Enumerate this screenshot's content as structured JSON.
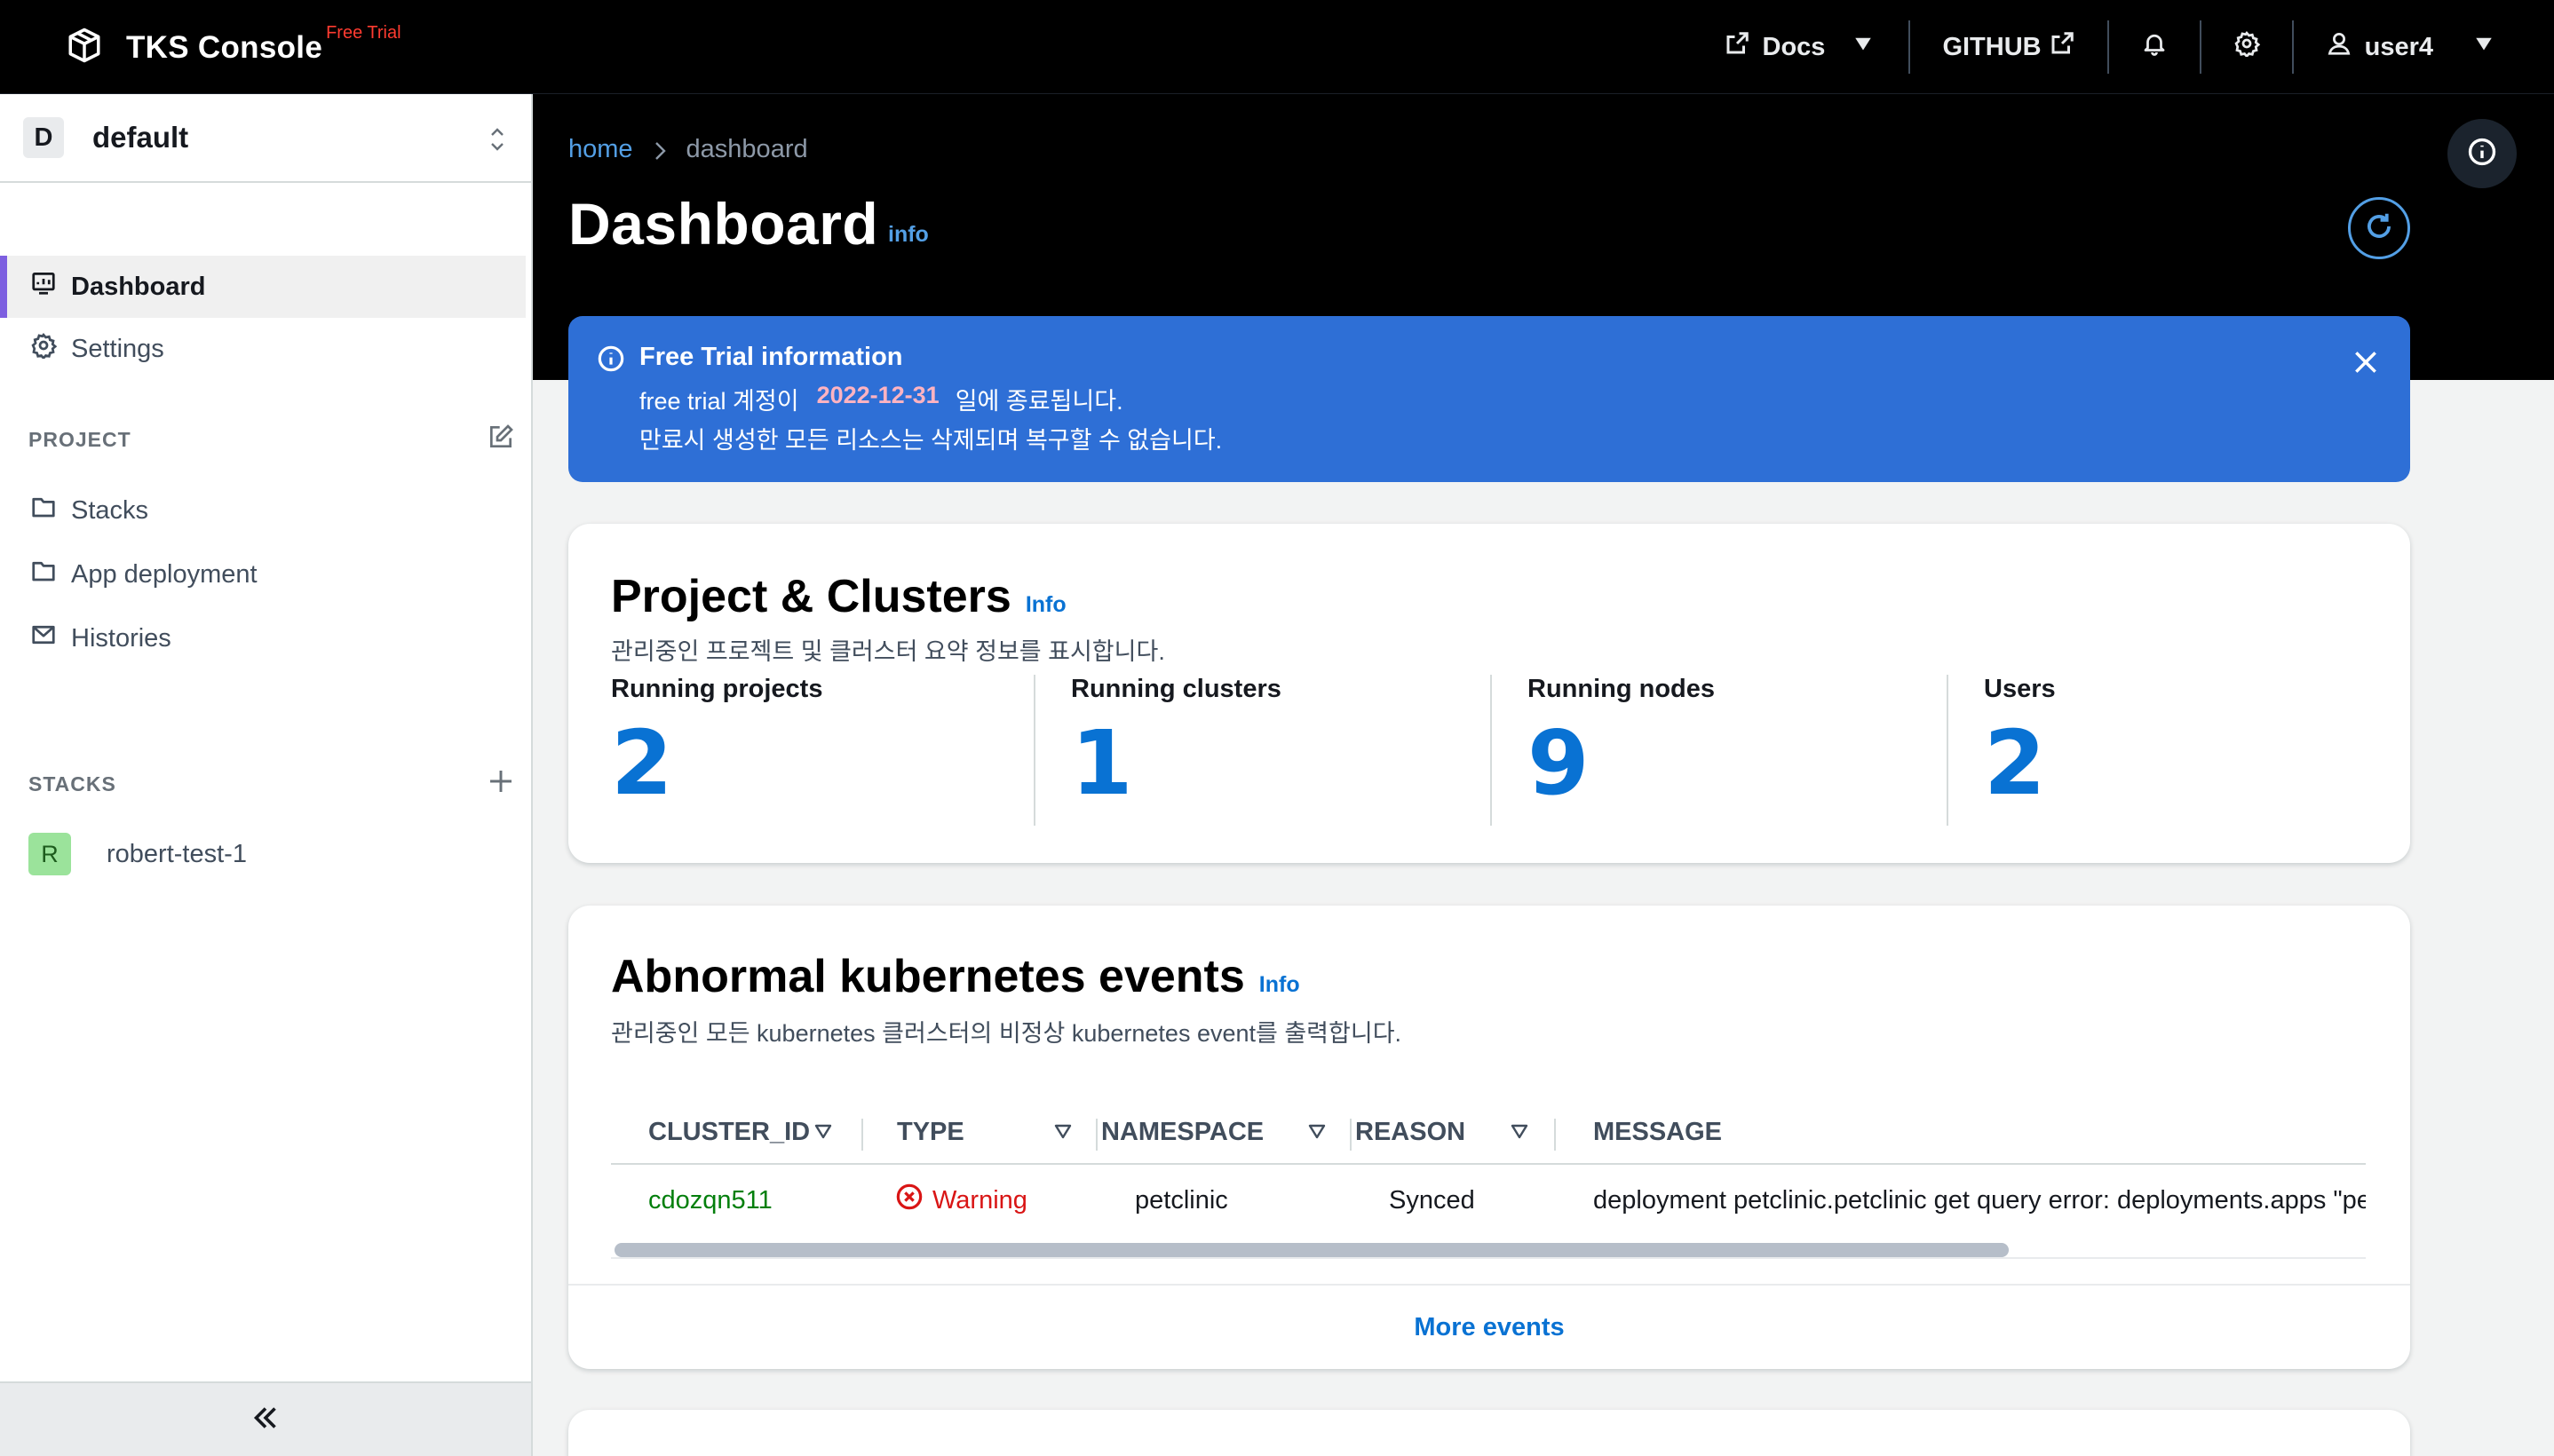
{
  "app": {
    "title": "TKS Console",
    "badge": "Free Trial",
    "logo_icon": "cube-logo-icon"
  },
  "topnav": {
    "docs_label": "Docs",
    "github_label": "GITHUB",
    "user_label": "user4",
    "icons": [
      "external-link-icon",
      "caret-down-icon",
      "bell-icon",
      "gear-icon",
      "user-icon"
    ]
  },
  "sidebar": {
    "project_initial": "D",
    "project_name": "default",
    "items": [
      {
        "label": "Dashboard",
        "icon": "dashboard-icon",
        "active": true
      },
      {
        "label": "Settings",
        "icon": "gear-icon",
        "active": false
      }
    ],
    "project_section": {
      "title": "PROJECT",
      "items": [
        {
          "label": "Stacks",
          "icon": "folder-icon"
        },
        {
          "label": "App deployment",
          "icon": "folder-icon"
        },
        {
          "label": "Histories",
          "icon": "envelope-icon"
        }
      ]
    },
    "stacks_section": {
      "title": "STACKS",
      "items": [
        {
          "initial": "R",
          "label": "robert-test-1"
        }
      ]
    }
  },
  "breadcrumb": {
    "home": "home",
    "current": "dashboard"
  },
  "page": {
    "title": "Dashboard",
    "info": "info"
  },
  "flash": {
    "title": "Free Trial information",
    "line1_prefix": "free trial 계정이",
    "date": "2022-12-31",
    "line1_suffix": "일에 종료됩니다.",
    "line2": "만료시 생성한 모든 리소스는 삭제되며 복구할 수 없습니다."
  },
  "summary": {
    "title": "Project & Clusters",
    "info": "Info",
    "description": "관리중인 프로젝트 및 클러스터 요약 정보를 표시합니다.",
    "metrics": [
      {
        "label": "Running projects",
        "value": "2"
      },
      {
        "label": "Running clusters",
        "value": "1"
      },
      {
        "label": "Running nodes",
        "value": "9"
      },
      {
        "label": "Users",
        "value": "2"
      }
    ]
  },
  "events": {
    "title": "Abnormal kubernetes events",
    "info": "Info",
    "description": "관리중인 모든 kubernetes 클러스터의 비정상 kubernetes event를 출력합니다.",
    "columns": [
      "CLUSTER_ID",
      "TYPE",
      "NAMESPACE",
      "REASON",
      "MESSAGE"
    ],
    "rows": [
      {
        "cluster_id": "cdozqn511",
        "type": "Warning",
        "namespace": "petclinic",
        "reason": "Synced",
        "message": "deployment petclinic.petclinic get query error: deployments.apps \"pet"
      }
    ],
    "more_label": "More events"
  },
  "colors": {
    "accent": "#0972d3",
    "flash_bg": "#2e6fd6",
    "warning": "#d91515",
    "cluster_link": "#037f0c",
    "active_indicator": "#7d5fe0"
  }
}
